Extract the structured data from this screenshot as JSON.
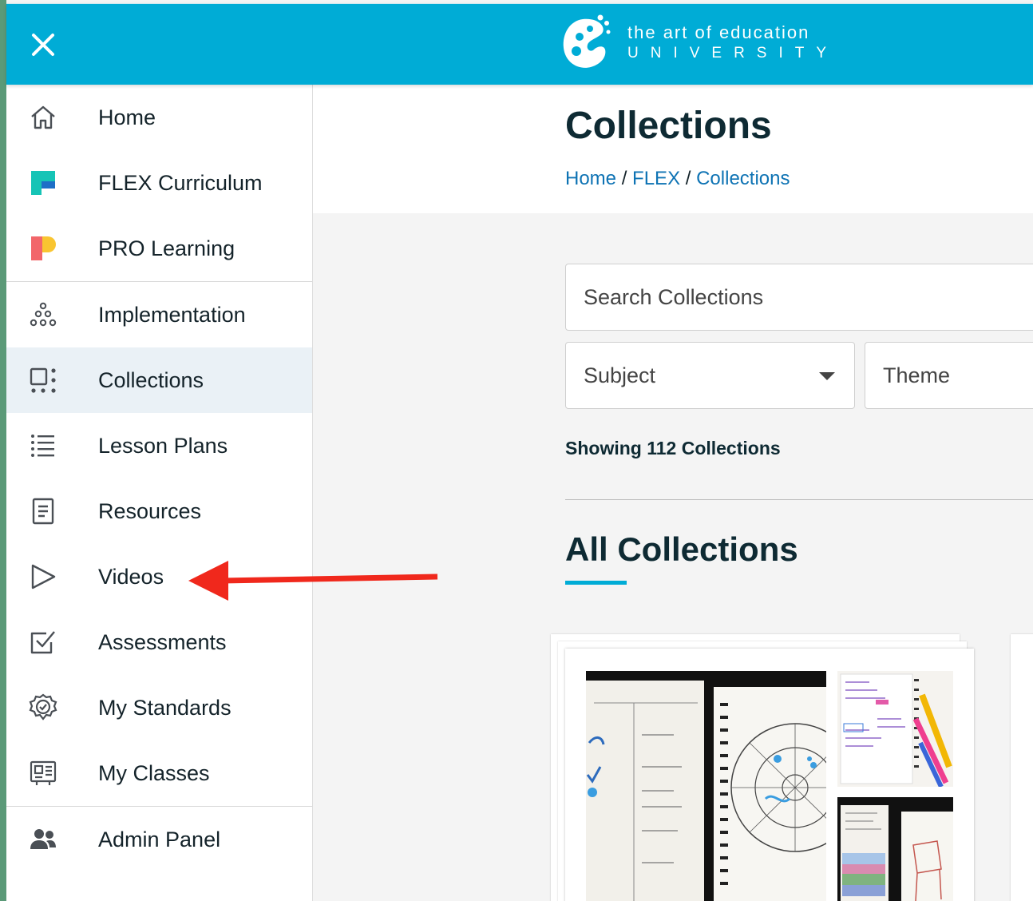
{
  "header": {
    "close_icon": "close-icon",
    "logo": {
      "line1": "the art of education",
      "line2": "UNIVERSITY"
    },
    "colors": {
      "bar": "#00acd6"
    }
  },
  "sidebar": {
    "items": [
      {
        "label": "Home",
        "icon": "home-icon"
      },
      {
        "label": "FLEX Curriculum",
        "icon": "flex-logo-icon"
      },
      {
        "label": "PRO Learning",
        "icon": "pro-logo-icon"
      },
      {
        "label": "Implementation",
        "icon": "dots-pyramid-icon"
      },
      {
        "label": "Collections",
        "icon": "collections-grid-icon",
        "active": true
      },
      {
        "label": "Lesson Plans",
        "icon": "list-icon"
      },
      {
        "label": "Resources",
        "icon": "document-icon"
      },
      {
        "label": "Videos",
        "icon": "play-icon"
      },
      {
        "label": "Assessments",
        "icon": "checkbox-icon"
      },
      {
        "label": "My Standards",
        "icon": "badge-gear-icon"
      },
      {
        "label": "My Classes",
        "icon": "id-card-icon"
      },
      {
        "label": "Admin Panel",
        "icon": "users-icon"
      }
    ]
  },
  "main": {
    "title": "Collections",
    "breadcrumb": {
      "home": "Home",
      "sep1": "/",
      "flex": "FLEX",
      "sep2": "/",
      "current": "Collections"
    },
    "search": {
      "placeholder": "Search Collections"
    },
    "filters": {
      "subject": "Subject",
      "theme": "Theme"
    },
    "showing": "Showing 112 Collections",
    "section_title": "All Collections"
  },
  "annotation": {
    "arrow_color": "#f0281c",
    "points_to": "Videos"
  }
}
